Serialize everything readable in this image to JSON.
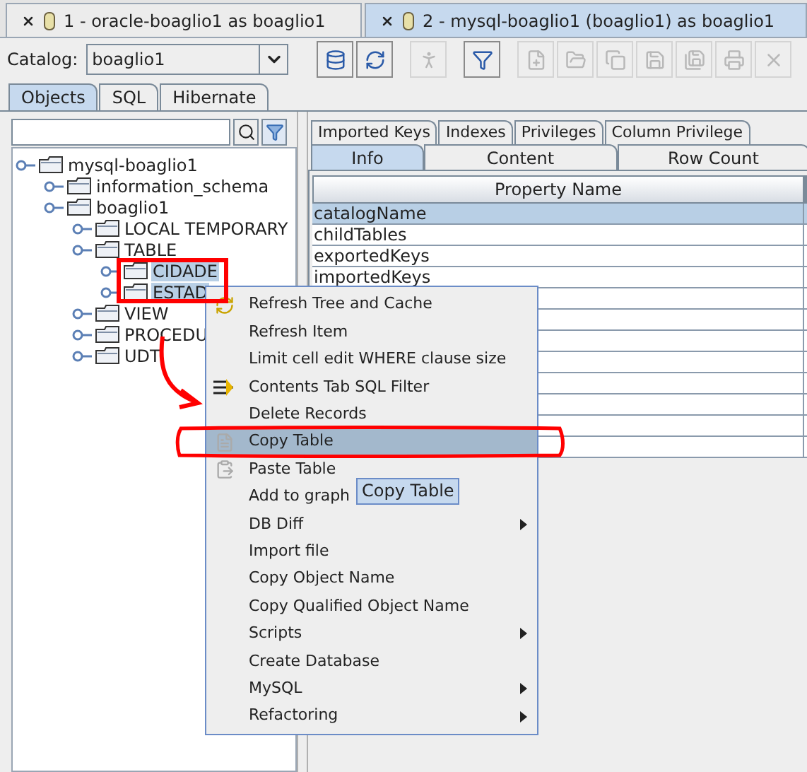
{
  "window_tabs": [
    {
      "label": "1 - oracle-boaglio1  as boaglio1",
      "selected": false
    },
    {
      "label": "2 - mysql-boaglio1 (boaglio1) as boaglio1",
      "selected": true
    }
  ],
  "toolbar": {
    "catalog_label": "Catalog:",
    "catalog_value": "boaglio1",
    "buttons": [
      {
        "kind": "sql",
        "disabled": false
      },
      {
        "kind": "refresh",
        "disabled": false
      },
      {
        "kind": "run",
        "disabled": true
      },
      {
        "kind": "filter",
        "disabled": false
      },
      {
        "kind": "new",
        "disabled": true
      },
      {
        "kind": "open",
        "disabled": true
      },
      {
        "kind": "copy",
        "disabled": true
      },
      {
        "kind": "save",
        "disabled": true
      },
      {
        "kind": "save-as",
        "disabled": true
      },
      {
        "kind": "print",
        "disabled": true
      },
      {
        "kind": "delete",
        "disabled": true
      }
    ]
  },
  "object_tabs": [
    {
      "label": "Objects",
      "selected": true
    },
    {
      "label": "SQL",
      "selected": false
    },
    {
      "label": "Hibernate",
      "selected": false
    }
  ],
  "tree": [
    {
      "label": "mysql-boaglio1",
      "selected": false,
      "children": [
        {
          "label": "information_schema",
          "selected": false
        },
        {
          "label": "boaglio1",
          "selected": false,
          "children": [
            {
              "label": "LOCAL TEMPORARY",
              "selected": false
            },
            {
              "label": "TABLE",
              "selected": false,
              "children": [
                {
                  "label": "CIDADE",
                  "selected": true
                },
                {
                  "label": "ESTAD",
                  "selected": true
                }
              ]
            },
            {
              "label": "VIEW",
              "selected": false
            },
            {
              "label": "PROCEDU",
              "selected": false
            },
            {
              "label": "UDT",
              "selected": false
            }
          ]
        }
      ]
    }
  ],
  "detail_tabs_top": [
    {
      "label": "Imported Keys",
      "selected": false
    },
    {
      "label": "Indexes",
      "selected": false
    },
    {
      "label": "Privileges",
      "selected": false
    },
    {
      "label": "Column Privilege",
      "selected": false
    }
  ],
  "detail_tabs_bottom": [
    {
      "label": "Info",
      "selected": true
    },
    {
      "label": "Content",
      "selected": false
    },
    {
      "label": "Row Count",
      "selected": false
    }
  ],
  "table": {
    "columns": [
      "Property Name"
    ],
    "rows": [
      {
        "cells": [
          "catalogName"
        ],
        "selected": true
      },
      {
        "cells": [
          "childTables"
        ],
        "selected": false
      },
      {
        "cells": [
          "exportedKeys"
        ],
        "selected": false
      },
      {
        "cells": [
          "importedKeys"
        ],
        "selected": false
      }
    ]
  },
  "context_menu": [
    {
      "label": "Refresh Tree and Cache",
      "kind": "refresh",
      "selected": false
    },
    {
      "label": "Refresh Item",
      "kind": "plain",
      "selected": false
    },
    {
      "label": "Limit cell edit WHERE clause size",
      "kind": "plain",
      "selected": false
    },
    {
      "label": "Contents Tab SQL Filter",
      "kind": "filter",
      "selected": false
    },
    {
      "label": "Delete Records",
      "kind": "plain",
      "selected": false
    },
    {
      "label": "Copy Table",
      "kind": "copy",
      "selected": true
    },
    {
      "label": "Paste Table",
      "kind": "paste",
      "selected": false
    },
    {
      "label": "Add to graph",
      "kind": "plain",
      "selected": false
    },
    {
      "label": "DB Diff",
      "kind": "submenu",
      "selected": false
    },
    {
      "label": "Import file",
      "kind": "plain",
      "selected": false
    },
    {
      "label": "Copy Object Name",
      "kind": "plain",
      "selected": false
    },
    {
      "label": "Copy Qualified Object Name",
      "kind": "plain",
      "selected": false
    },
    {
      "label": "Scripts",
      "kind": "submenu",
      "selected": false
    },
    {
      "label": "Create Database",
      "kind": "plain",
      "selected": false
    },
    {
      "label": "MySQL",
      "kind": "submenu",
      "selected": false
    },
    {
      "label": "Refactoring",
      "kind": "submenu",
      "selected": false
    }
  ],
  "tooltip": "Copy Table"
}
